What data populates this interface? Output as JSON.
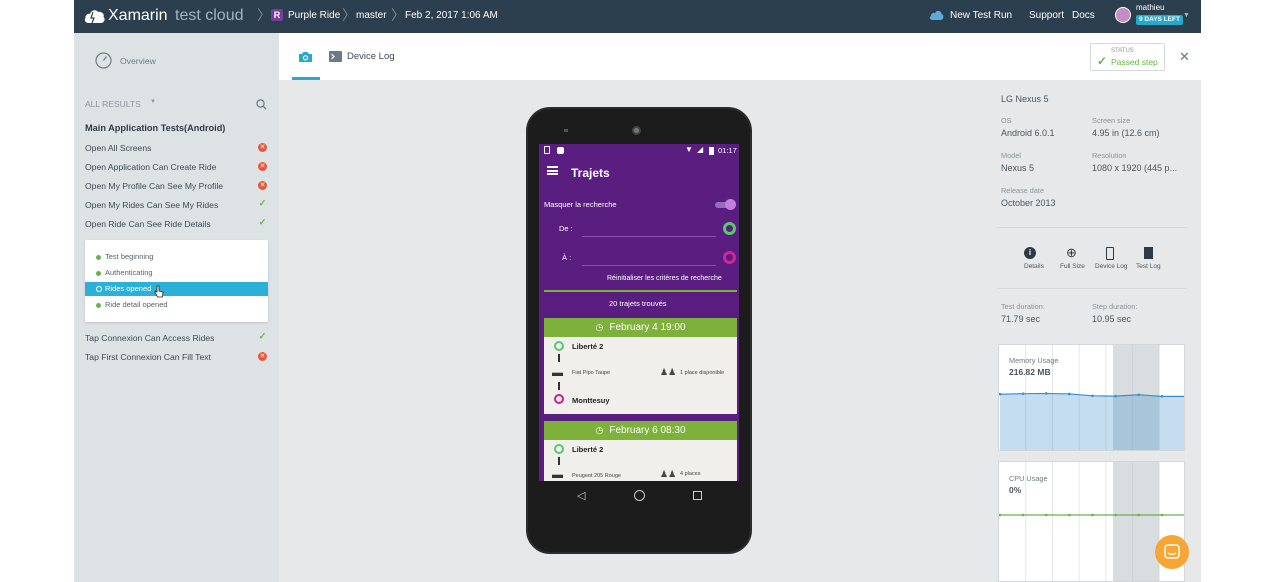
{
  "topbar": {
    "brand_name": "Xamarin",
    "brand_suffix": "test cloud",
    "breadcrumb": [
      {
        "label": "Purple Ride",
        "badge": "R"
      },
      {
        "label": "master"
      },
      {
        "label": "Feb 2, 2017 1:06 AM"
      }
    ],
    "new_test_run": "New Test Run",
    "support": "Support",
    "docs": "Docs",
    "username": "mathieu",
    "days_left": "9 DAYS LEFT",
    "bg_color": "#2c3f4e"
  },
  "sidebar": {
    "overview": "Overview",
    "all_results": "ALL RESULTS",
    "group_title": "Main Application Tests(Android)",
    "tests": [
      {
        "label": "Open All Screens",
        "status": "failed"
      },
      {
        "label": "Open Application Can Create Ride",
        "status": "failed"
      },
      {
        "label": "Open My Profile Can See My Profile",
        "status": "failed"
      },
      {
        "label": "Open My Rides Can See My Rides",
        "status": "passed"
      },
      {
        "label": "Open Ride Can See Ride Details",
        "status": "passed"
      },
      {
        "label": "Tap Connexion Can Access Rides",
        "status": "passed"
      },
      {
        "label": "Tap First Connexion Can Fill Text",
        "status": "failed"
      }
    ],
    "steps": [
      {
        "label": "Test beginning",
        "selected": false
      },
      {
        "label": "Authenticating",
        "selected": false
      },
      {
        "label": "Rides opened",
        "selected": true
      },
      {
        "label": "Ride detail opened",
        "selected": false
      }
    ]
  },
  "tabs": {
    "screenshot_icon": "camera-icon",
    "device_log": "Device Log"
  },
  "status": {
    "label": "STATUS",
    "value": "Passed step"
  },
  "phone": {
    "time": "01:17",
    "app_title": "Trajets",
    "hide_search": "Masquer la recherche",
    "from_label": "De :",
    "to_label": "À :",
    "reset": "Réinitialiser les critères de recherche",
    "found": "20 trajets trouvés",
    "rides": [
      {
        "date": "February 4 19:00",
        "from": "Liberté 2",
        "car": "Fiat Pipo Taupe",
        "seats": "1 place disponible",
        "to": "Monttesuy"
      },
      {
        "date": "February 6 08:30",
        "from": "Liberté 2",
        "car": "Peugeot 205 Rouge",
        "seats": "4 places",
        "to": ""
      }
    ]
  },
  "device": {
    "name": "LG Nexus 5",
    "os_label": "OS",
    "os": "Android 6.0.1",
    "screen_label": "Screen size",
    "screen": "4.95 in (12.6 cm)",
    "model_label": "Model",
    "model": "Nexus 5",
    "resolution_label": "Resolution",
    "resolution": "1080 x 1920 (445 p...",
    "release_label": "Release date",
    "release": "October 2013",
    "actions": [
      "Details",
      "Full Size",
      "Device Log",
      "Test Log"
    ],
    "test_duration_label": "Test duration:",
    "test_duration": "71.79 sec",
    "step_duration_label": "Step duration:",
    "step_duration": "10.95 sec"
  },
  "charts": {
    "memory_label": "Memory Usage",
    "memory_value": "216.82 MB",
    "cpu_label": "CPU Usage",
    "cpu_value": "0%"
  },
  "chart_data": [
    {
      "type": "area",
      "title": "Memory Usage",
      "values": [
        216,
        218,
        219,
        217,
        210,
        209,
        214,
        208,
        208
      ],
      "ylim": [
        0,
        400
      ]
    },
    {
      "type": "line",
      "title": "CPU Usage",
      "values": [
        0,
        0,
        0,
        0,
        0,
        0,
        0,
        0,
        0
      ],
      "ylim": [
        0,
        100
      ]
    }
  ]
}
